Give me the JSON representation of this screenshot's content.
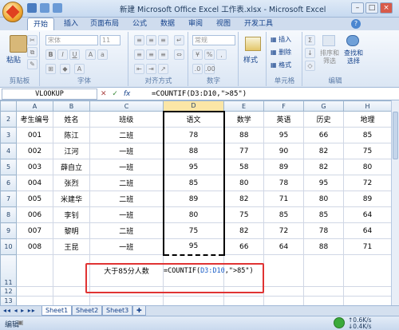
{
  "title": "新建 Microsoft Office Excel 工作表.xlsx - Microsoft Excel",
  "tabs": [
    "开始",
    "插入",
    "页面布局",
    "公式",
    "数据",
    "审阅",
    "视图",
    "开发工具"
  ],
  "ribbon": {
    "paste": "粘贴",
    "font_name": "宋体",
    "font_size": "11",
    "number_format": "常规",
    "style": "样式",
    "sort_filter": "排序和\n筛选",
    "find_select": "查找和\n选择",
    "insert": "插入",
    "delete": "删除",
    "format": "格式",
    "groups": [
      "剪贴板",
      "字体",
      "对齐方式",
      "数字",
      "单元格",
      "编辑"
    ]
  },
  "formula_bar": {
    "name_box": "VLOOKUP",
    "formula": "=COUNTIF(D3:D10,\">85\")"
  },
  "sheet": {
    "columns": [
      "A",
      "B",
      "C",
      "D",
      "E",
      "F",
      "G",
      "H"
    ],
    "rows": [
      {
        "n": "2",
        "c": [
          "考生编号",
          "姓名",
          "班级",
          "语文",
          "数学",
          "英语",
          "历史",
          "地理"
        ]
      },
      {
        "n": "3",
        "c": [
          "001",
          "陈江",
          "二班",
          "78",
          "88",
          "95",
          "66",
          "85"
        ]
      },
      {
        "n": "4",
        "c": [
          "002",
          "江河",
          "一班",
          "88",
          "77",
          "90",
          "82",
          "75"
        ]
      },
      {
        "n": "5",
        "c": [
          "003",
          "薛自立",
          "一班",
          "95",
          "58",
          "89",
          "82",
          "80"
        ]
      },
      {
        "n": "6",
        "c": [
          "004",
          "张烈",
          "二班",
          "85",
          "80",
          "78",
          "95",
          "72"
        ]
      },
      {
        "n": "7",
        "c": [
          "005",
          "米建华",
          "二班",
          "89",
          "82",
          "71",
          "80",
          "89"
        ]
      },
      {
        "n": "8",
        "c": [
          "006",
          "李钊",
          "一班",
          "80",
          "75",
          "85",
          "85",
          "64"
        ]
      },
      {
        "n": "9",
        "c": [
          "007",
          "黎明",
          "二班",
          "75",
          "82",
          "72",
          "78",
          "64"
        ]
      },
      {
        "n": "10",
        "c": [
          "008",
          "王昆",
          "一班",
          "95",
          "66",
          "64",
          "88",
          "71"
        ]
      }
    ],
    "row11": {
      "n": "11",
      "label": "大于85分人数",
      "formula": "=COUNTIF(D3:D10,\">85\")"
    },
    "row12": "12",
    "row13": "13"
  },
  "sheet_tabs": [
    "Sheet1",
    "Sheet2",
    "Sheet3"
  ],
  "status": {
    "mode": "编辑",
    "speed1": "0.6K/s",
    "speed2": "0.4K/s"
  },
  "colors": {
    "highlight": "#e03333",
    "selected_col": "#fbe6a6"
  }
}
